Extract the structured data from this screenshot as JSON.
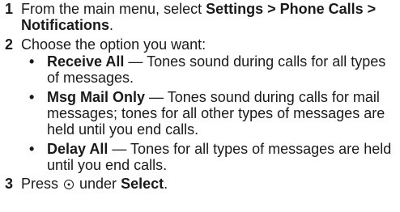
{
  "steps": [
    {
      "number": "1",
      "text_before": "From the main menu, select ",
      "menu_path": "Settings > Phone Calls > Notifications",
      "text_after": "."
    },
    {
      "number": "2",
      "text": "Choose the option you want:",
      "options": [
        {
          "bullet": "•",
          "name": "Receive All",
          "description": " — Tones sound during calls for all types of messages."
        },
        {
          "bullet": "•",
          "name": "Msg Mail Only",
          "description": " — Tones sound during calls for mail messages; tones for all other types of messages are held until you end calls."
        },
        {
          "bullet": "•",
          "name": "Delay All",
          "description": " — Tones for all types of messages are held until you end calls."
        }
      ]
    },
    {
      "number": "3",
      "text_before": "Press ",
      "key_icon": "center-select-key-icon",
      "text_middle": " under ",
      "softkey": "Select",
      "text_after": "."
    }
  ]
}
